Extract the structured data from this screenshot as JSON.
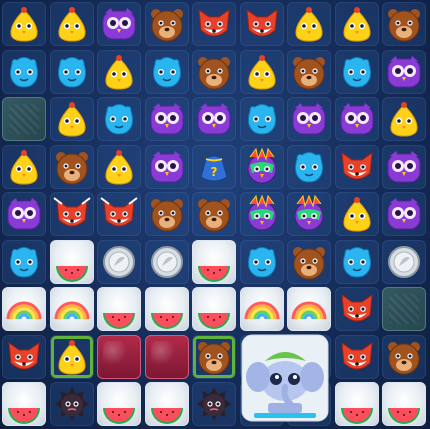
{
  "game": {
    "board": {
      "columns": 9,
      "rows": 9,
      "cells": [
        [
          "chick",
          "chick",
          "owl",
          "bear",
          "fox",
          "fox",
          "chick",
          "chick",
          "bear"
        ],
        [
          "blob",
          "blob",
          "chick",
          "blob",
          "bear",
          "chick",
          "bear",
          "blob",
          "owl"
        ],
        [
          "stone",
          "chick",
          "blob",
          "owl",
          "owl",
          "blob",
          "owl",
          "owl",
          "chick"
        ],
        [
          "chick",
          "bear",
          "chick",
          "owl",
          "bag",
          "bird",
          "blob",
          "fox",
          "owl"
        ],
        [
          "owl",
          "fox-striped",
          "fox-striped",
          "bear",
          "bear",
          "bird",
          "bird",
          "chick",
          "owl"
        ],
        [
          "blob",
          "watermelon",
          "coin",
          "coin",
          "watermelon",
          "blob",
          "bear",
          "blob",
          "coin"
        ],
        [
          "rainbow",
          "rainbow",
          "watermelon",
          "watermelon",
          "watermelon",
          "rainbow",
          "rainbow",
          "fox",
          "stone"
        ],
        [
          "fox",
          "chick-vine",
          "jam",
          "jam",
          "bear-vine",
          "elephant",
          "",
          "fox",
          "bear"
        ],
        [
          "watermelon",
          "spiky",
          "watermelon",
          "watermelon",
          "spiky",
          "",
          "",
          "watermelon",
          "watermelon"
        ]
      ],
      "cloud_rows": [
        5,
        6,
        8
      ],
      "cloud_cells": [
        [
          5,
          1
        ],
        [
          5,
          4
        ],
        [
          6,
          0
        ],
        [
          6,
          1
        ],
        [
          6,
          2
        ],
        [
          6,
          3
        ],
        [
          6,
          4
        ],
        [
          6,
          5
        ],
        [
          6,
          6
        ],
        [
          8,
          0
        ],
        [
          8,
          2
        ],
        [
          8,
          3
        ],
        [
          8,
          7
        ],
        [
          8,
          8
        ]
      ]
    },
    "colors": {
      "chick": "#ffd21a",
      "owl": "#8a3bd6",
      "bear": "#a0521f",
      "fox": "#e8412a",
      "blob": "#2ab4f0",
      "board_bg": "#142a55"
    },
    "icon_names": [
      "chick-icon",
      "owl-icon",
      "bear-icon",
      "fox-icon",
      "blob-icon",
      "watermelon-icon",
      "coin-icon",
      "rainbow-icon",
      "magic-bag-icon",
      "rainbow-bird-icon",
      "jam-block-icon",
      "spiky-ball-icon",
      "elephant-icon",
      "stone-block-icon"
    ]
  }
}
